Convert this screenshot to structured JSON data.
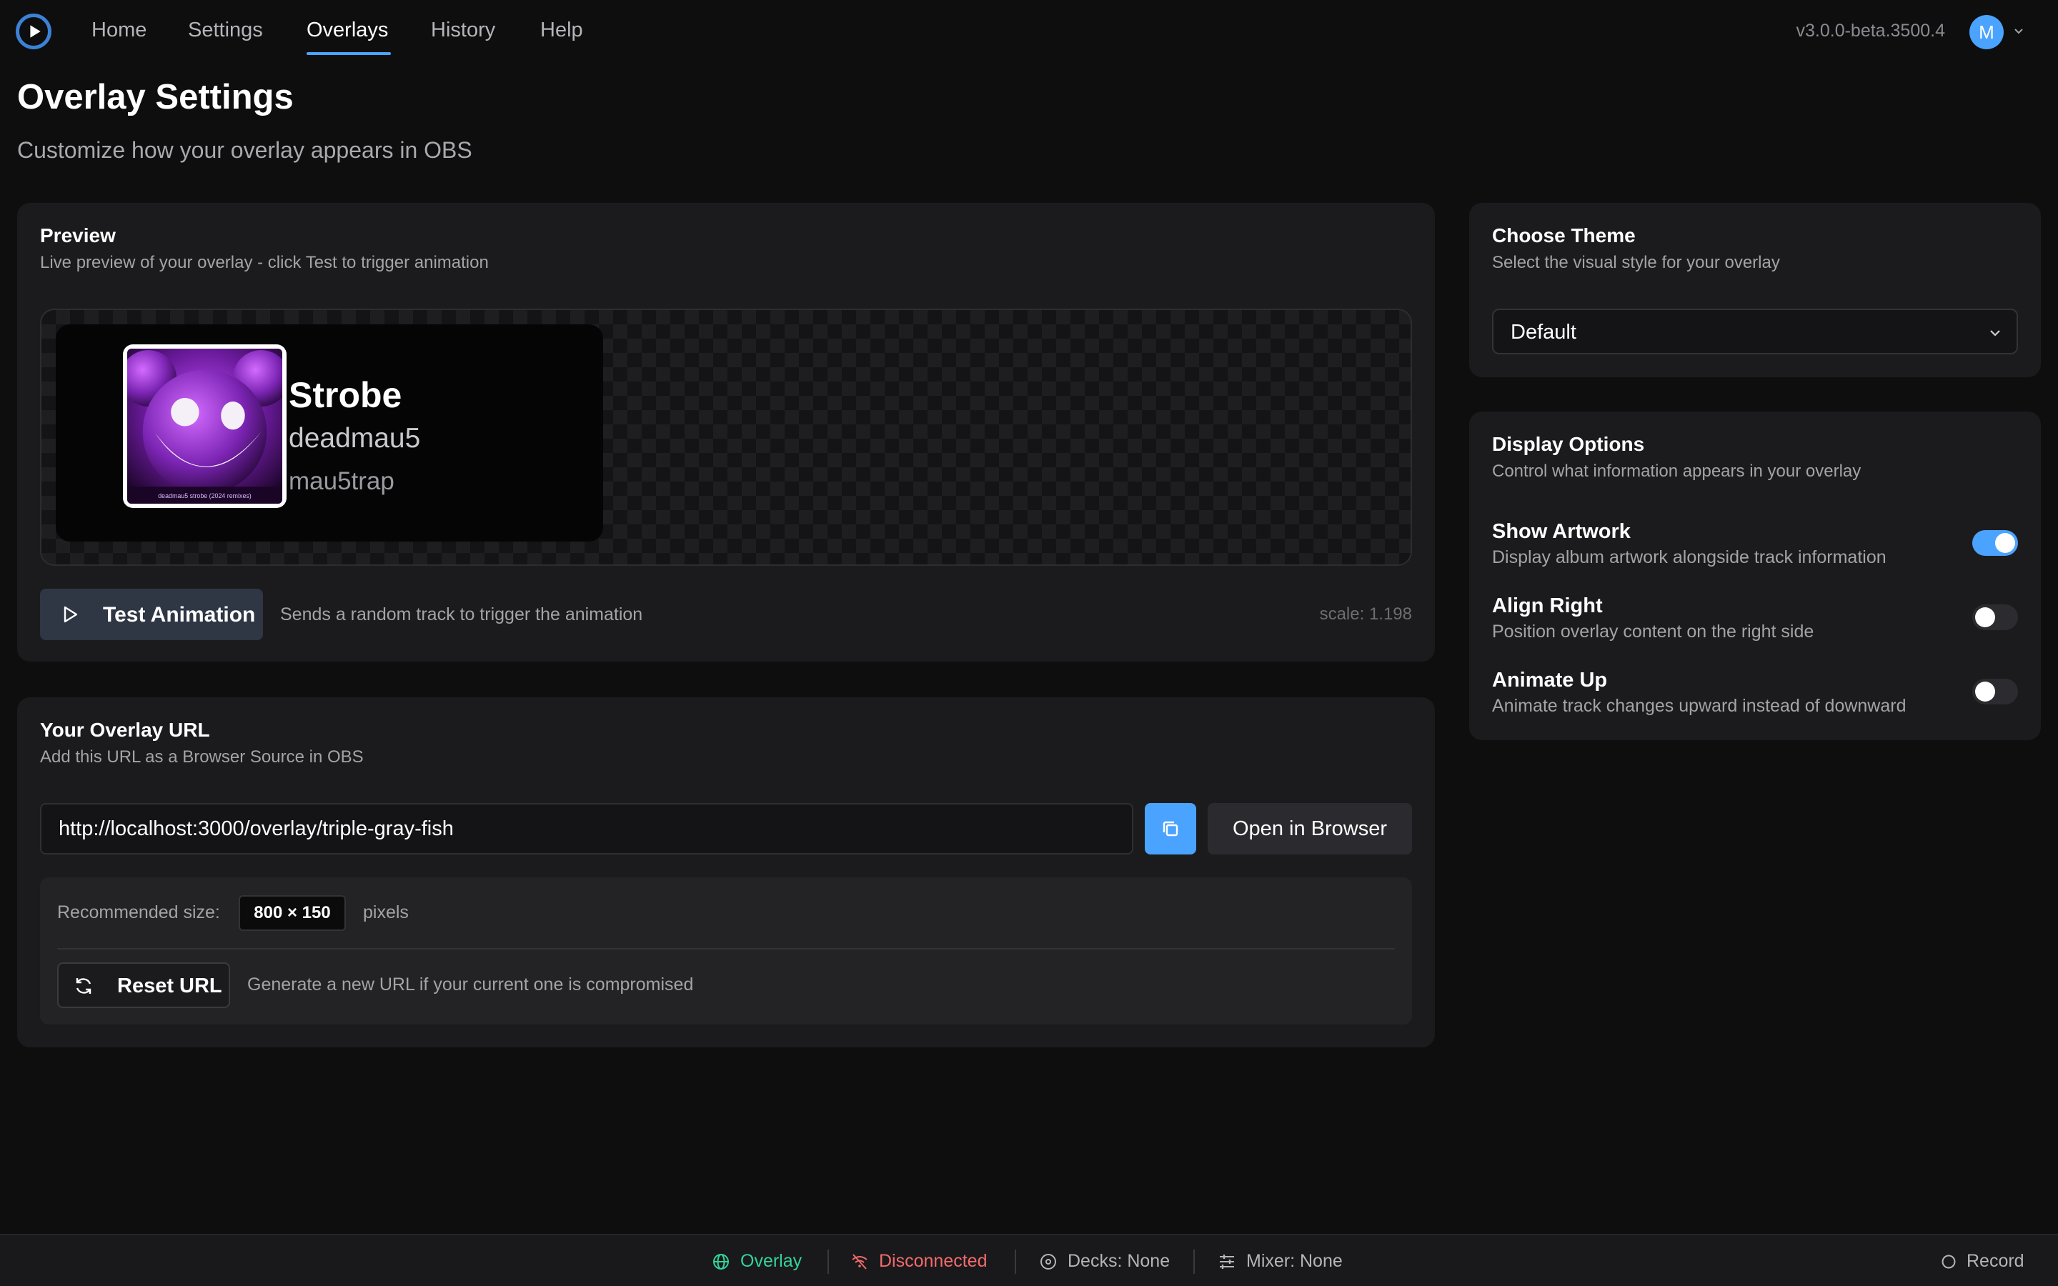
{
  "nav": {
    "items": [
      {
        "label": "Home"
      },
      {
        "label": "Settings"
      },
      {
        "label": "Overlays"
      },
      {
        "label": "History"
      },
      {
        "label": "Help"
      }
    ],
    "active": "Overlays",
    "version": "v3.0.0-beta.3500.4",
    "avatar_initial": "M"
  },
  "header": {
    "title": "Overlay Settings",
    "subtitle": "Customize how your overlay appears in OBS"
  },
  "preview": {
    "title": "Preview",
    "subtitle": "Live preview of your overlay - click Test to trigger animation",
    "track": {
      "title": "Strobe",
      "artist": "deadmau5",
      "album": "mau5trap",
      "artwork_caption": "deadmau5 strobe (2024 remixes)"
    },
    "test_button": "Test Animation",
    "test_hint": "Sends a random track to trigger the animation",
    "scale": "scale: 1.198"
  },
  "url_section": {
    "title": "Your Overlay URL",
    "subtitle": "Add this URL as a Browser Source in OBS",
    "url": "http://localhost:3000/overlay/triple-gray-fish",
    "open_button": "Open in Browser",
    "recommended_label": "Recommended size:",
    "recommended_size": "800 × 150",
    "recommended_unit": "pixels",
    "reset_button": "Reset URL",
    "reset_hint": "Generate a new URL if your current one is compromised"
  },
  "theme": {
    "title": "Choose Theme",
    "subtitle": "Select the visual style for your overlay",
    "selected": "Default"
  },
  "display_options": {
    "title": "Display Options",
    "subtitle": "Control what information appears in your overlay",
    "options": [
      {
        "label": "Show Artwork",
        "description": "Display album artwork alongside track information",
        "enabled": true
      },
      {
        "label": "Align Right",
        "description": "Position overlay content on the right side",
        "enabled": false
      },
      {
        "label": "Animate Up",
        "description": "Animate track changes upward instead of downward",
        "enabled": false
      }
    ]
  },
  "status_bar": {
    "overlay": "Overlay",
    "connection": "Disconnected",
    "decks": "Decks: None",
    "mixer": "Mixer: None",
    "record": "Record"
  },
  "colors": {
    "accent": "#4aa3ff",
    "ok": "#34d399",
    "error": "#f26b6b"
  }
}
